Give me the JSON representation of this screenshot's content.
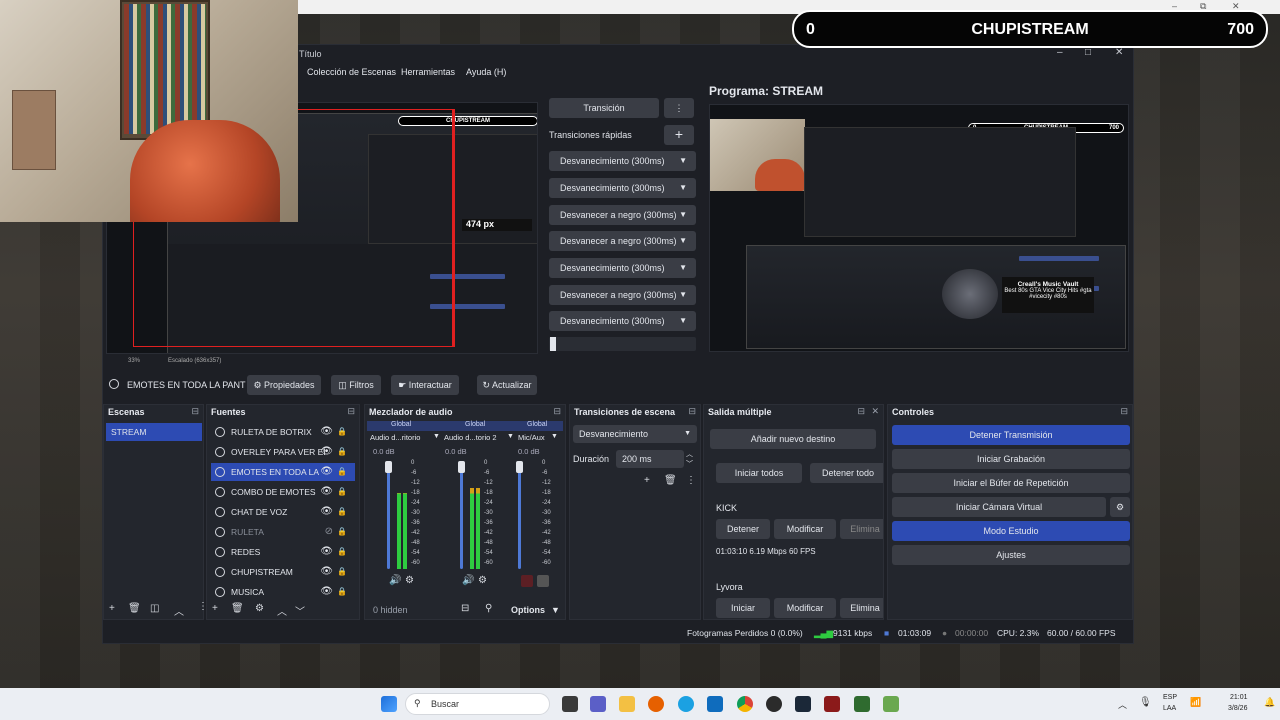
{
  "top_bar": {
    "min": "–",
    "max": "⧉",
    "close": "✕"
  },
  "window": {
    "title": "Título",
    "min": "–",
    "max": "□",
    "close": "✕"
  },
  "menu": [
    "Colección de Escenas",
    "Herramientas",
    "Ayuda (H)"
  ],
  "overlay": {
    "left": "0",
    "title": "CHUPISTREAM",
    "right": "700"
  },
  "preview_left": {
    "label": "474 px",
    "zoom": "33%",
    "scale": "Escalado (636x357)",
    "overlay_title": "CHUPISTREAM"
  },
  "program": {
    "title": "Programa: STREAM",
    "overlay_left": "0",
    "overlay_title": "CHUPISTREAM",
    "overlay_right": "700",
    "music_title": "Creall's Music Vault",
    "music_sub1": "Best 80s GTA Vice City Hits #gta",
    "music_sub2": "#vicecity #80s"
  },
  "transitions_col": {
    "transition_btn": "Transición",
    "menu_icon": "⋮",
    "quick_label": "Transiciones rápidas",
    "add": "+",
    "items": [
      "Desvanecimiento (300ms)",
      "Desvanecimiento (300ms)",
      "Desvanecer a negro (300ms)",
      "Desvanecer a negro (300ms)",
      "Desvanecimiento (300ms)",
      "Desvanecer a negro (300ms)",
      "Desvanecimiento (300ms)"
    ]
  },
  "source_toolbar": {
    "selected": "EMOTES EN TODA LA PANT",
    "properties": "Propiedades",
    "filters": "Filtros",
    "interact": "Interactuar",
    "refresh": "Actualizar"
  },
  "scenes": {
    "header": "Escenas",
    "items": [
      "STREAM"
    ]
  },
  "sources": {
    "header": "Fuentes",
    "items": [
      {
        "name": "RULETA DE BOTRIX",
        "visible": "👁",
        "lock": "🔒"
      },
      {
        "name": "OVERLEY PARA VER EI",
        "visible": "👁",
        "lock": "🔒"
      },
      {
        "name": "EMOTES EN TODA LA",
        "visible": "👁",
        "lock": "🔒"
      },
      {
        "name": "COMBO DE EMOTES",
        "visible": "👁",
        "lock": "🔒"
      },
      {
        "name": "CHAT DE VOZ",
        "visible": "👁",
        "lock": "🔒"
      },
      {
        "name": "RULETA",
        "visible": "⊘",
        "lock": "🔒"
      },
      {
        "name": "REDES",
        "visible": "👁",
        "lock": "🔒"
      },
      {
        "name": "CHUPISTREAM",
        "visible": "👁",
        "lock": "🔒"
      },
      {
        "name": "MUSICA",
        "visible": "👁",
        "lock": "🔒"
      }
    ]
  },
  "mixer": {
    "header": "Mezclador de audio",
    "channels": [
      {
        "scope": "Global",
        "name": "Audio d...ritorio",
        "db": "0.0 dB",
        "level": 0.7
      },
      {
        "scope": "Global",
        "name": "Audio d...torio 2",
        "db": "0.0 dB",
        "level": 0.75
      },
      {
        "scope": "Global",
        "name": "Mic/Aux",
        "db": "0.0 dB",
        "level": 0.0
      }
    ],
    "ticks": [
      "0",
      "-6",
      "-12",
      "-18",
      "-24",
      "-30",
      "-36",
      "-42",
      "-48",
      "-54",
      "-60"
    ],
    "hidden": "0 hidden",
    "options": "Options"
  },
  "scene_transitions": {
    "header": "Transiciones de escena",
    "type": "Desvanecimiento",
    "duration_label": "Duración",
    "duration": "200 ms"
  },
  "multi_output": {
    "header": "Salida múltiple",
    "add": "Añadir nuevo destino",
    "start_all": "Iniciar todos",
    "stop_all": "Detener todo",
    "dest1": {
      "name": "KICK",
      "stop": "Detener",
      "modify": "Modificar",
      "delete": "Elimina",
      "stats": "01:03:10  6.19 Mbps  60 FPS"
    },
    "dest2": {
      "name": "Lyvora",
      "start": "Iniciar",
      "modify": "Modificar",
      "delete": "Elimina"
    }
  },
  "controls": {
    "header": "Controles",
    "stop_stream": "Detener Transmisión",
    "start_rec": "Iniciar Grabación",
    "replay": "Iniciar el Búfer de Repetición",
    "virtual_cam": "Iniciar Cámara Virtual",
    "studio": "Modo Estudio",
    "settings": "Ajustes"
  },
  "status": {
    "dropped": "Fotogramas Perdidos 0 (0.0%)",
    "kbps": "9131 kbps",
    "live": "01:03:09",
    "rec": "00:00:00",
    "cpu": "CPU: 2.3%",
    "fps": "60.00 / 60.00 FPS"
  },
  "taskbar": {
    "search": "Buscar",
    "lang1": "ESP",
    "lang2": "LAA",
    "time": "21:01",
    "date": "3/8/26"
  },
  "colors": {
    "accent": "#2d4bb3",
    "panel": "#23262d"
  }
}
